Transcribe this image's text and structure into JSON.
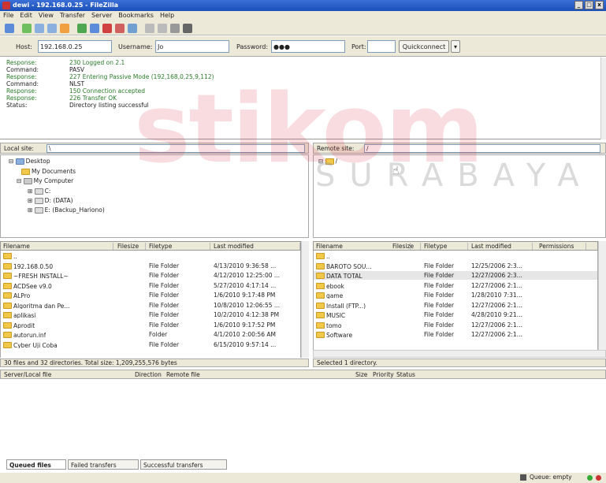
{
  "window": {
    "title": "dewi - 192.168.0.25 - FileZilla",
    "min": "_",
    "max": "□",
    "close": "x"
  },
  "menu": [
    "File",
    "Edit",
    "View",
    "Transfer",
    "Server",
    "Bookmarks",
    "Help"
  ],
  "quickconnect": {
    "host_label": "Host:",
    "host_value": "192.168.0.25",
    "user_label": "Username:",
    "user_value": "Jo",
    "pass_label": "Password:",
    "pass_value": "●●●",
    "port_label": "Port:",
    "port_value": "",
    "button": "Quickconnect",
    "dropdown": "▾"
  },
  "log": [
    {
      "k": "Response:",
      "v": "230 Logged on 2.1"
    },
    {
      "k": "Command:",
      "v": "PASV"
    },
    {
      "k": "Response:",
      "v": "227 Entering Passive Mode (192,168,0,25,9,112)"
    },
    {
      "k": "Command:",
      "v": "NLST"
    },
    {
      "k": "Response:",
      "v": "150 Connection accepted"
    },
    {
      "k": "Response:",
      "v": "226 Transfer OK"
    },
    {
      "k": "Status:",
      "v": "Directory listing successful"
    }
  ],
  "local": {
    "site_label": "Local site:",
    "site_value": "\\",
    "tree": [
      "Desktop",
      "My Documents",
      "My Computer",
      "C:",
      "D: (DATA)",
      "E: (Backup_Hariono)"
    ],
    "columns": [
      "Filename",
      "Filesize",
      "Filetype",
      "Last modified"
    ],
    "files": [
      {
        "name": "..",
        "size": "",
        "type": "",
        "modified": ""
      },
      {
        "name": "192.168.0.50",
        "size": "",
        "type": "File Folder",
        "modified": "4/13/2010 9:36:58 ..."
      },
      {
        "name": "~FRESH INSTALL~",
        "size": "",
        "type": "File Folder",
        "modified": "4/12/2010 12:25:00 ..."
      },
      {
        "name": "ACDSee v9.0",
        "size": "",
        "type": "File Folder",
        "modified": "5/27/2010 4:17:14 ..."
      },
      {
        "name": "ALPro",
        "size": "",
        "type": "File Folder",
        "modified": "1/6/2010 9:17:48 PM"
      },
      {
        "name": "Algoritma dan Pe...",
        "size": "",
        "type": "File Folder",
        "modified": "10/8/2010 12:06:55 ..."
      },
      {
        "name": "aplikasi",
        "size": "",
        "type": "File Folder",
        "modified": "10/2/2010 4:12:38 PM"
      },
      {
        "name": "Aprodit",
        "size": "",
        "type": "File Folder",
        "modified": "1/6/2010 9:17:52 PM"
      },
      {
        "name": "autorun.inf",
        "size": "",
        "type": "Folder",
        "modified": "4/1/2010 2:00:56 AM"
      },
      {
        "name": "Cyber Uji Coba",
        "size": "",
        "type": "File Folder",
        "modified": "6/15/2010 9:57:14 ..."
      }
    ],
    "status": "30 files and 32 directories. Total size: 1,209,255,576 bytes"
  },
  "remote": {
    "site_label": "Remote site:",
    "site_value": "/",
    "tree": [
      "/"
    ],
    "columns": [
      "Filename",
      "Filesize",
      "Filetype",
      "Last modified",
      "Permissions"
    ],
    "files": [
      {
        "name": "..",
        "type": "",
        "modified": ""
      },
      {
        "name": "BAROTO SOU...",
        "type": "File Folder",
        "modified": "12/25/2006 2:3..."
      },
      {
        "name": "DATA TOTAL",
        "type": "File Folder",
        "modified": "12/27/2006 2:3..."
      },
      {
        "name": "ebook",
        "type": "File Folder",
        "modified": "12/27/2006 2:1..."
      },
      {
        "name": "game",
        "type": "File Folder",
        "modified": "1/28/2010 7:31..."
      },
      {
        "name": "Install (FTP...)",
        "type": "File Folder",
        "modified": "12/27/2006 2:1..."
      },
      {
        "name": "MUSIC",
        "type": "File Folder",
        "modified": "4/28/2010 9:21..."
      },
      {
        "name": "tomo",
        "type": "File Folder",
        "modified": "12/27/2006 2:1..."
      },
      {
        "name": "Software",
        "type": "File Folder",
        "modified": "12/27/2006 2:1..."
      }
    ],
    "status": "Selected 1 directory."
  },
  "queue": {
    "columns": [
      "Server/Local file",
      "Direction",
      "Remote file",
      "Size",
      "Priority",
      "Status"
    ],
    "tabs": [
      "Queued files",
      "Failed transfers",
      "Successful transfers"
    ]
  },
  "statusbar": {
    "queue": "Queue: empty"
  },
  "watermark": {
    "big": "stikom",
    "sub": "SURABAYA"
  },
  "colors": {
    "accent": "#1b4fb8",
    "folder": "#f2c84b",
    "watermark": "#dc3c50"
  }
}
